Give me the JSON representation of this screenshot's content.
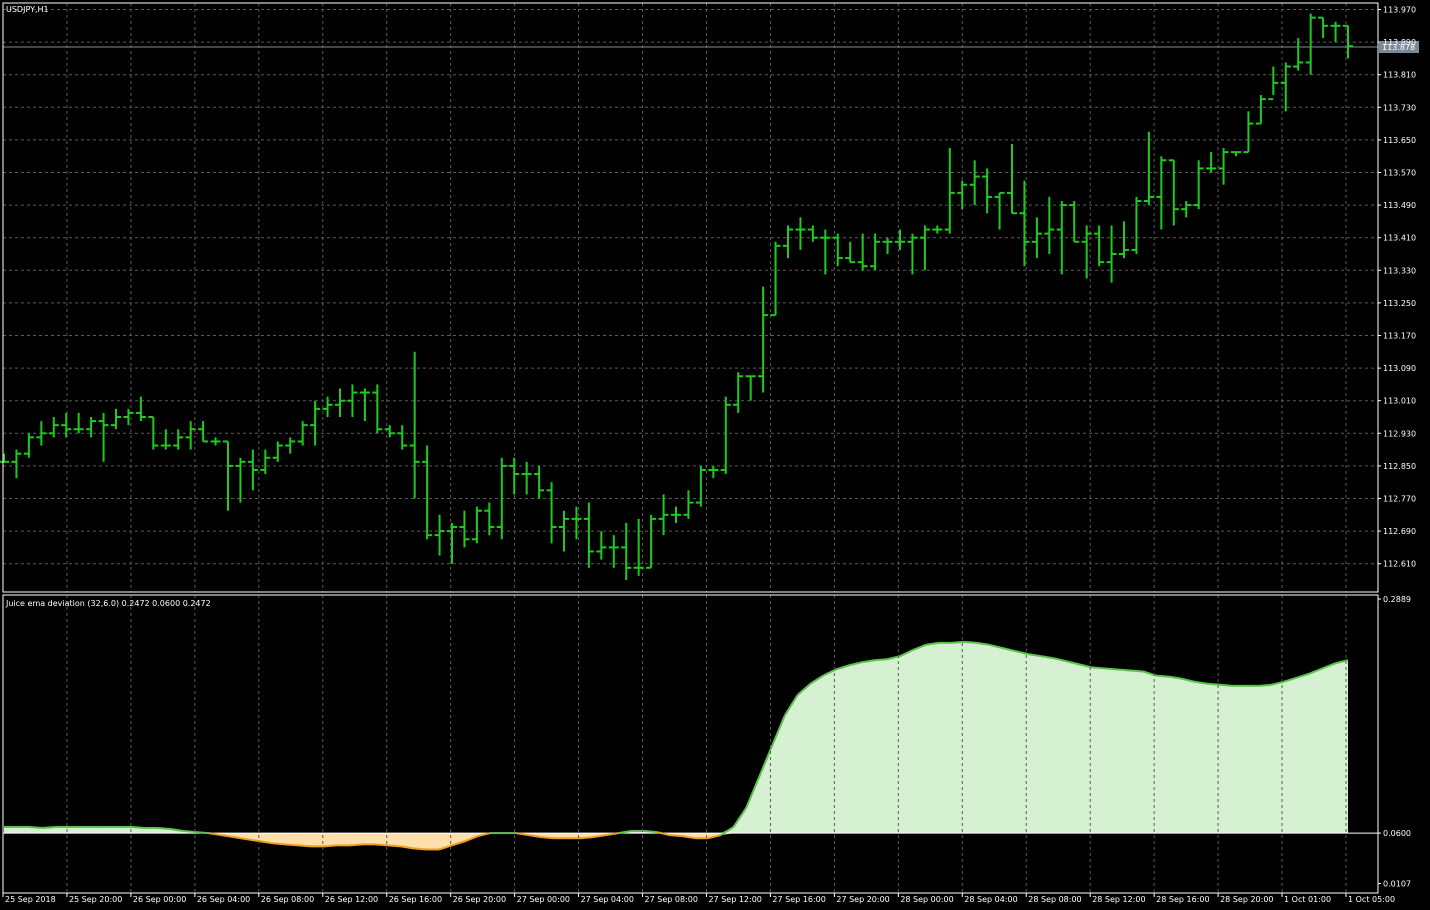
{
  "colors": {
    "background": "#000000",
    "grid": "#5a5a5a",
    "frame": "#ffffff",
    "bar": "#1ecb1e",
    "text": "#ffffff",
    "price_line": "#7a8a9a",
    "price_label_bg": "#7a8a9a",
    "pos_fill": "#d6f0d2",
    "pos_line": "#5cc34c",
    "neg_fill": "#ffdfaa",
    "neg_line": "#f0a020"
  },
  "chart_data": [
    {
      "type": "ohlc",
      "title": "USDJPY,H1",
      "current_price_label": "113.878",
      "current_price": 113.878,
      "ylim": [
        112.52,
        114.0
      ],
      "y_ticks": [
        "113.970",
        "113.890",
        "113.810",
        "113.730",
        "113.650",
        "113.570",
        "113.490",
        "113.410",
        "113.330",
        "113.250",
        "113.170",
        "113.090",
        "113.010",
        "112.930",
        "112.850",
        "112.770",
        "112.690",
        "112.610"
      ],
      "grid": true,
      "bars": [
        {
          "o": 112.86,
          "h": 112.88,
          "l": 112.86,
          "c": 112.86
        },
        {
          "o": 112.86,
          "h": 112.89,
          "l": 112.82,
          "c": 112.88
        },
        {
          "o": 112.88,
          "h": 112.93,
          "l": 112.87,
          "c": 112.92
        },
        {
          "o": 112.92,
          "h": 112.96,
          "l": 112.9,
          "c": 112.93
        },
        {
          "o": 112.93,
          "h": 112.97,
          "l": 112.92,
          "c": 112.95
        },
        {
          "o": 112.95,
          "h": 112.98,
          "l": 112.92,
          "c": 112.94
        },
        {
          "o": 112.94,
          "h": 112.98,
          "l": 112.93,
          "c": 112.94
        },
        {
          "o": 112.94,
          "h": 112.97,
          "l": 112.92,
          "c": 112.96
        },
        {
          "o": 112.96,
          "h": 112.98,
          "l": 112.86,
          "c": 112.95
        },
        {
          "o": 112.95,
          "h": 112.99,
          "l": 112.94,
          "c": 112.97
        },
        {
          "o": 112.97,
          "h": 112.99,
          "l": 112.95,
          "c": 112.98
        },
        {
          "o": 112.98,
          "h": 113.02,
          "l": 112.96,
          "c": 112.97
        },
        {
          "o": 112.97,
          "h": 112.97,
          "l": 112.89,
          "c": 112.9
        },
        {
          "o": 112.9,
          "h": 112.94,
          "l": 112.89,
          "c": 112.9
        },
        {
          "o": 112.9,
          "h": 112.94,
          "l": 112.89,
          "c": 112.92
        },
        {
          "o": 112.92,
          "h": 112.96,
          "l": 112.89,
          "c": 112.94
        },
        {
          "o": 112.94,
          "h": 112.96,
          "l": 112.91,
          "c": 112.91
        },
        {
          "o": 112.91,
          "h": 112.92,
          "l": 112.9,
          "c": 112.91
        },
        {
          "o": 112.91,
          "h": 112.91,
          "l": 112.74,
          "c": 112.85
        },
        {
          "o": 112.85,
          "h": 112.87,
          "l": 112.76,
          "c": 112.86
        },
        {
          "o": 112.86,
          "h": 112.89,
          "l": 112.79,
          "c": 112.84
        },
        {
          "o": 112.84,
          "h": 112.89,
          "l": 112.83,
          "c": 112.87
        },
        {
          "o": 112.87,
          "h": 112.91,
          "l": 112.86,
          "c": 112.9
        },
        {
          "o": 112.9,
          "h": 112.92,
          "l": 112.88,
          "c": 112.91
        },
        {
          "o": 112.91,
          "h": 112.96,
          "l": 112.9,
          "c": 112.95
        },
        {
          "o": 112.95,
          "h": 113.01,
          "l": 112.9,
          "c": 112.99
        },
        {
          "o": 112.99,
          "h": 113.02,
          "l": 112.97,
          "c": 113.0
        },
        {
          "o": 113.0,
          "h": 113.04,
          "l": 112.97,
          "c": 113.01
        },
        {
          "o": 113.01,
          "h": 113.05,
          "l": 112.97,
          "c": 113.03
        },
        {
          "o": 113.03,
          "h": 113.04,
          "l": 112.96,
          "c": 113.03
        },
        {
          "o": 113.03,
          "h": 113.05,
          "l": 112.93,
          "c": 112.94
        },
        {
          "o": 112.94,
          "h": 112.95,
          "l": 112.92,
          "c": 112.93
        },
        {
          "o": 112.93,
          "h": 112.95,
          "l": 112.89,
          "c": 112.9
        },
        {
          "o": 112.9,
          "h": 113.13,
          "l": 112.77,
          "c": 112.86
        },
        {
          "o": 112.86,
          "h": 112.9,
          "l": 112.67,
          "c": 112.68
        },
        {
          "o": 112.68,
          "h": 112.73,
          "l": 112.63,
          "c": 112.69
        },
        {
          "o": 112.69,
          "h": 112.71,
          "l": 112.61,
          "c": 112.7
        },
        {
          "o": 112.7,
          "h": 112.74,
          "l": 112.65,
          "c": 112.67
        },
        {
          "o": 112.67,
          "h": 112.75,
          "l": 112.66,
          "c": 112.74
        },
        {
          "o": 112.74,
          "h": 112.76,
          "l": 112.68,
          "c": 112.7
        },
        {
          "o": 112.7,
          "h": 112.87,
          "l": 112.67,
          "c": 112.85
        },
        {
          "o": 112.85,
          "h": 112.87,
          "l": 112.78,
          "c": 112.83
        },
        {
          "o": 112.83,
          "h": 112.86,
          "l": 112.78,
          "c": 112.83
        },
        {
          "o": 112.83,
          "h": 112.85,
          "l": 112.77,
          "c": 112.79
        },
        {
          "o": 112.79,
          "h": 112.81,
          "l": 112.66,
          "c": 112.7
        },
        {
          "o": 112.7,
          "h": 112.74,
          "l": 112.64,
          "c": 112.72
        },
        {
          "o": 112.72,
          "h": 112.75,
          "l": 112.67,
          "c": 112.72
        },
        {
          "o": 112.72,
          "h": 112.76,
          "l": 112.6,
          "c": 112.64
        },
        {
          "o": 112.64,
          "h": 112.69,
          "l": 112.62,
          "c": 112.65
        },
        {
          "o": 112.65,
          "h": 112.68,
          "l": 112.6,
          "c": 112.65
        },
        {
          "o": 112.65,
          "h": 112.71,
          "l": 112.57,
          "c": 112.6
        },
        {
          "o": 112.6,
          "h": 112.72,
          "l": 112.58,
          "c": 112.6
        },
        {
          "o": 112.6,
          "h": 112.73,
          "l": 112.6,
          "c": 112.72
        },
        {
          "o": 112.72,
          "h": 112.78,
          "l": 112.68,
          "c": 112.73
        },
        {
          "o": 112.73,
          "h": 112.75,
          "l": 112.71,
          "c": 112.73
        },
        {
          "o": 112.73,
          "h": 112.79,
          "l": 112.72,
          "c": 112.76
        },
        {
          "o": 112.76,
          "h": 112.85,
          "l": 112.75,
          "c": 112.84
        },
        {
          "o": 112.84,
          "h": 112.85,
          "l": 112.82,
          "c": 112.84
        },
        {
          "o": 112.84,
          "h": 113.02,
          "l": 112.83,
          "c": 113.0
        },
        {
          "o": 113.0,
          "h": 113.08,
          "l": 112.98,
          "c": 113.07
        },
        {
          "o": 113.07,
          "h": 113.07,
          "l": 113.01,
          "c": 113.07
        },
        {
          "o": 113.07,
          "h": 113.29,
          "l": 113.03,
          "c": 113.22
        },
        {
          "o": 113.22,
          "h": 113.4,
          "l": 113.22,
          "c": 113.39
        },
        {
          "o": 113.39,
          "h": 113.44,
          "l": 113.36,
          "c": 113.43
        },
        {
          "o": 113.43,
          "h": 113.46,
          "l": 113.38,
          "c": 113.43
        },
        {
          "o": 113.43,
          "h": 113.44,
          "l": 113.4,
          "c": 113.41
        },
        {
          "o": 113.41,
          "h": 113.43,
          "l": 113.32,
          "c": 113.41
        },
        {
          "o": 113.41,
          "h": 113.42,
          "l": 113.34,
          "c": 113.36
        },
        {
          "o": 113.36,
          "h": 113.4,
          "l": 113.35,
          "c": 113.35
        },
        {
          "o": 113.35,
          "h": 113.42,
          "l": 113.33,
          "c": 113.34
        },
        {
          "o": 113.34,
          "h": 113.42,
          "l": 113.33,
          "c": 113.4
        },
        {
          "o": 113.4,
          "h": 113.41,
          "l": 113.37,
          "c": 113.4
        },
        {
          "o": 113.4,
          "h": 113.43,
          "l": 113.38,
          "c": 113.4
        },
        {
          "o": 113.4,
          "h": 113.42,
          "l": 113.32,
          "c": 113.41
        },
        {
          "o": 113.41,
          "h": 113.44,
          "l": 113.33,
          "c": 113.43
        },
        {
          "o": 113.43,
          "h": 113.44,
          "l": 113.42,
          "c": 113.43
        },
        {
          "o": 113.43,
          "h": 113.63,
          "l": 113.42,
          "c": 113.52
        },
        {
          "o": 113.52,
          "h": 113.55,
          "l": 113.48,
          "c": 113.54
        },
        {
          "o": 113.54,
          "h": 113.6,
          "l": 113.49,
          "c": 113.56
        },
        {
          "o": 113.56,
          "h": 113.58,
          "l": 113.47,
          "c": 113.51
        },
        {
          "o": 113.51,
          "h": 113.52,
          "l": 113.43,
          "c": 113.52
        },
        {
          "o": 113.52,
          "h": 113.64,
          "l": 113.47,
          "c": 113.47
        },
        {
          "o": 113.47,
          "h": 113.55,
          "l": 113.34,
          "c": 113.4
        },
        {
          "o": 113.4,
          "h": 113.46,
          "l": 113.36,
          "c": 113.42
        },
        {
          "o": 113.42,
          "h": 113.51,
          "l": 113.37,
          "c": 113.43
        },
        {
          "o": 113.43,
          "h": 113.5,
          "l": 113.32,
          "c": 113.49
        },
        {
          "o": 113.49,
          "h": 113.5,
          "l": 113.4,
          "c": 113.4
        },
        {
          "o": 113.4,
          "h": 113.44,
          "l": 113.31,
          "c": 113.42
        },
        {
          "o": 113.42,
          "h": 113.44,
          "l": 113.34,
          "c": 113.35
        },
        {
          "o": 113.35,
          "h": 113.44,
          "l": 113.3,
          "c": 113.37
        },
        {
          "o": 113.37,
          "h": 113.45,
          "l": 113.36,
          "c": 113.38
        },
        {
          "o": 113.38,
          "h": 113.51,
          "l": 113.37,
          "c": 113.5
        },
        {
          "o": 113.5,
          "h": 113.67,
          "l": 113.49,
          "c": 113.51
        },
        {
          "o": 113.51,
          "h": 113.61,
          "l": 113.43,
          "c": 113.6
        },
        {
          "o": 113.6,
          "h": 113.6,
          "l": 113.44,
          "c": 113.48
        },
        {
          "o": 113.48,
          "h": 113.5,
          "l": 113.46,
          "c": 113.49
        },
        {
          "o": 113.49,
          "h": 113.6,
          "l": 113.48,
          "c": 113.58
        },
        {
          "o": 113.58,
          "h": 113.62,
          "l": 113.57,
          "c": 113.58
        },
        {
          "o": 113.58,
          "h": 113.63,
          "l": 113.54,
          "c": 113.62
        },
        {
          "o": 113.62,
          "h": 113.62,
          "l": 113.61,
          "c": 113.62
        },
        {
          "o": 113.62,
          "h": 113.72,
          "l": 113.62,
          "c": 113.69
        },
        {
          "o": 113.69,
          "h": 113.76,
          "l": 113.69,
          "c": 113.75
        },
        {
          "o": 113.75,
          "h": 113.83,
          "l": 113.76,
          "c": 113.79
        },
        {
          "o": 113.79,
          "h": 113.84,
          "l": 113.72,
          "c": 113.83
        },
        {
          "o": 113.83,
          "h": 113.9,
          "l": 113.82,
          "c": 113.84
        },
        {
          "o": 113.84,
          "h": 113.96,
          "l": 113.81,
          "c": 113.95
        },
        {
          "o": 113.95,
          "h": 113.95,
          "l": 113.9,
          "c": 113.93
        },
        {
          "o": 113.93,
          "h": 113.94,
          "l": 113.89,
          "c": 113.93
        },
        {
          "o": 113.93,
          "h": 113.93,
          "l": 113.85,
          "c": 113.88
        }
      ]
    },
    {
      "type": "area",
      "title": "Juice ema deviation (32,6.0) 0.2472 0.0600 0.2472",
      "level": 0.06,
      "ylim": [
        0.0107,
        0.2889
      ],
      "y_ticks": [
        "0.2889",
        "0.0600",
        "0.0107"
      ],
      "values": [
        0.066,
        0.066,
        0.066,
        0.065,
        0.066,
        0.066,
        0.066,
        0.066,
        0.066,
        0.066,
        0.066,
        0.065,
        0.065,
        0.064,
        0.062,
        0.061,
        0.06,
        0.058,
        0.056,
        0.054,
        0.052,
        0.05,
        0.049,
        0.048,
        0.047,
        0.047,
        0.048,
        0.048,
        0.049,
        0.049,
        0.048,
        0.047,
        0.045,
        0.044,
        0.044,
        0.048,
        0.052,
        0.057,
        0.06,
        0.06,
        0.06,
        0.058,
        0.056,
        0.055,
        0.055,
        0.055,
        0.056,
        0.058,
        0.06,
        0.062,
        0.062,
        0.061,
        0.058,
        0.057,
        0.055,
        0.055,
        0.058,
        0.066,
        0.085,
        0.115,
        0.145,
        0.175,
        0.195,
        0.206,
        0.214,
        0.22,
        0.224,
        0.227,
        0.229,
        0.23,
        0.233,
        0.239,
        0.244,
        0.246,
        0.246,
        0.247,
        0.246,
        0.244,
        0.241,
        0.238,
        0.235,
        0.233,
        0.231,
        0.228,
        0.225,
        0.222,
        0.221,
        0.22,
        0.219,
        0.218,
        0.214,
        0.213,
        0.211,
        0.208,
        0.206,
        0.205,
        0.204,
        0.204,
        0.204,
        0.205,
        0.208,
        0.212,
        0.216,
        0.221,
        0.226,
        0.229
      ]
    }
  ],
  "x_axis": {
    "labels": [
      "25 Sep 2018",
      "25 Sep 20:00",
      "26 Sep 00:00",
      "26 Sep 04:00",
      "26 Sep 08:00",
      "26 Sep 12:00",
      "26 Sep 16:00",
      "26 Sep 20:00",
      "27 Sep 00:00",
      "27 Sep 04:00",
      "27 Sep 08:00",
      "27 Sep 12:00",
      "27 Sep 16:00",
      "27 Sep 20:00",
      "28 Sep 00:00",
      "28 Sep 04:00",
      "28 Sep 08:00",
      "28 Sep 12:00",
      "28 Sep 16:00",
      "28 Sep 20:00",
      "1 Oct 01:00",
      "1 Oct 05:00"
    ]
  }
}
